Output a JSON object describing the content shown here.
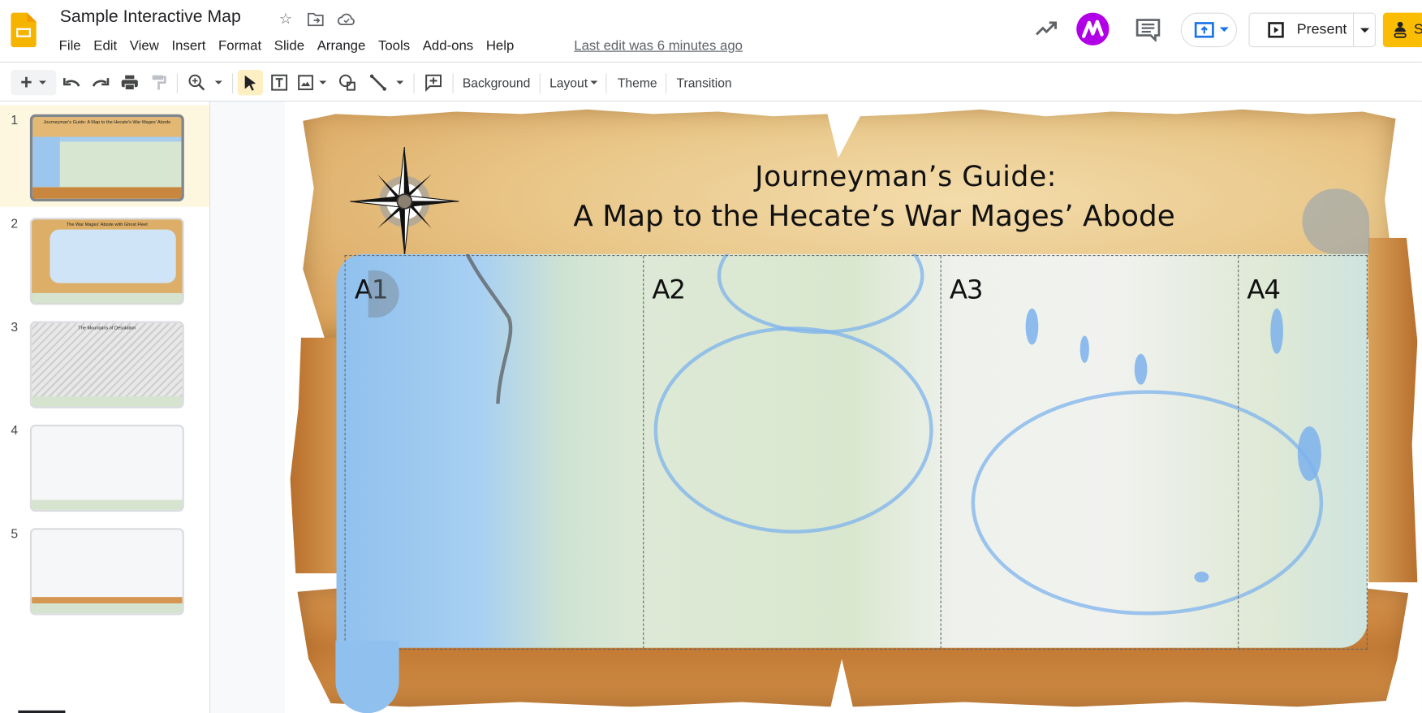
{
  "app": {
    "title": "Sample Interactive Map",
    "menu": [
      "File",
      "Edit",
      "View",
      "Insert",
      "Format",
      "Slide",
      "Arrange",
      "Tools",
      "Add-ons",
      "Help"
    ],
    "last_edit": "Last edit was 6 minutes ago",
    "present_label": "Present",
    "share_label": "S",
    "brand_color": "#f4b400",
    "share_color": "#fbbc04",
    "addon_color": "#b100e8"
  },
  "toolbar": {
    "background_label": "Background",
    "layout_label": "Layout",
    "theme_label": "Theme",
    "transition_label": "Transition"
  },
  "filmstrip": {
    "slides": [
      {
        "number": "1",
        "title": "Journeyman's Guide: A Map to the Hecate's War Mages' Abode",
        "selected": true
      },
      {
        "number": "2",
        "title": "The War Mages' Abode with Ghost Fleet",
        "selected": false
      },
      {
        "number": "3",
        "title": "The Mountains of Desolation",
        "selected": false
      },
      {
        "number": "4",
        "title": "",
        "selected": false
      },
      {
        "number": "5",
        "title": "",
        "selected": false
      }
    ]
  },
  "slide": {
    "title_line1": "Journeyman’s Guide:",
    "title_line2": "A Map to the Hecate’s War Mages’ Abode",
    "grid_labels": [
      "A1",
      "A2",
      "A3",
      "A4"
    ]
  }
}
